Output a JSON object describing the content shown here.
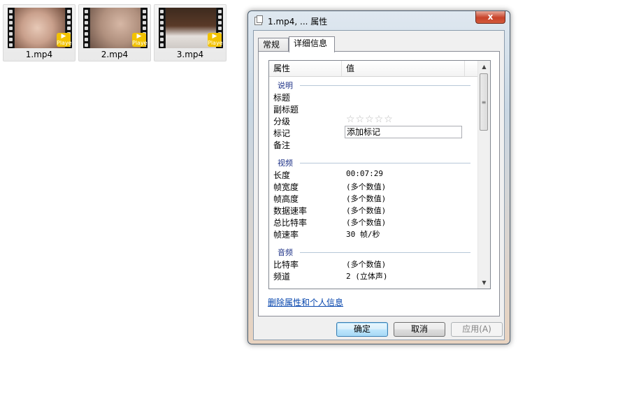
{
  "files": [
    {
      "name": "1.mp4",
      "frame_color": "#c9a08c",
      "badge": "Player"
    },
    {
      "name": "2.mp4",
      "frame_color": "#b0907e",
      "badge": "Player"
    },
    {
      "name": "3.mp4",
      "frame_color": "#5a3a28",
      "badge": "Player"
    }
  ],
  "dialog": {
    "title": "1.mp4, ... 属性",
    "close_symbol": "x",
    "tabs": [
      {
        "label": "常规"
      },
      {
        "label": "详细信息"
      }
    ],
    "columns": {
      "property": "属性",
      "value": "值"
    },
    "groups": {
      "description": {
        "label": "说明",
        "title": "标题",
        "subtitle": "副标题",
        "rating": "分级",
        "rating_stars": "☆☆☆☆☆",
        "tags": "标记",
        "tags_value": "添加标记",
        "comments": "备注"
      },
      "video": {
        "label": "视频",
        "rows": [
          {
            "key": "长度",
            "value": "00:07:29"
          },
          {
            "key": "帧宽度",
            "value": "(多个数值)"
          },
          {
            "key": "帧高度",
            "value": "(多个数值)"
          },
          {
            "key": "数据速率",
            "value": "(多个数值)"
          },
          {
            "key": "总比特率",
            "value": "(多个数值)"
          },
          {
            "key": "帧速率",
            "value": "30 帧/秒"
          }
        ]
      },
      "audio": {
        "label": "音频",
        "rows": [
          {
            "key": "比特率",
            "value": "(多个数值)"
          },
          {
            "key": "频道",
            "value": "2 (立体声)"
          }
        ]
      }
    },
    "remove_link": "删除属性和个人信息",
    "buttons": {
      "ok": "确定",
      "cancel": "取消",
      "apply": "应用(A)"
    }
  }
}
